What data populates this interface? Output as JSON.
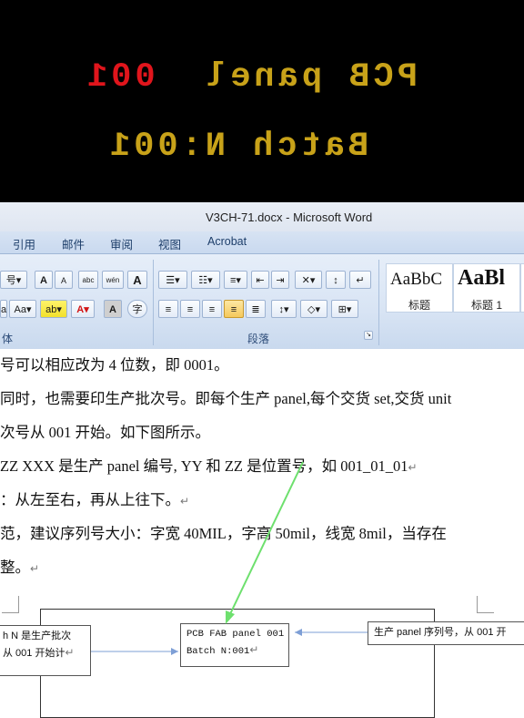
{
  "pcb_preview": {
    "line1_number": "001",
    "line1_text": "PCB panel",
    "line2_text": "Batch N:001",
    "number_color": "#e0151c",
    "text_color": "#c8a219"
  },
  "window": {
    "title": "V3CH-71.docx - Microsoft Word"
  },
  "tabs": [
    "引用",
    "邮件",
    "审阅",
    "视图",
    "Acrobat"
  ],
  "ribbon": {
    "font_group_label": "体",
    "paragraph_group_label": "段落",
    "font_buttons": [
      "号",
      "A",
      "A",
      "abc",
      "wén",
      "A"
    ],
    "font_buttons_row2": [
      "a",
      "Aa",
      "ab",
      "A",
      "A",
      "字"
    ],
    "styles": [
      {
        "sample": "AaBbC",
        "name": "标题"
      },
      {
        "sample": "AaBl",
        "name": "标题 1"
      }
    ]
  },
  "document": {
    "lines": [
      "号可以相应改为 4 位数，即 0001。",
      "同时，也需要印生产批次号。即每个生产 panel,每个交货 set,交货 unit",
      "次号从 001 开始。如下图所示。",
      "ZZ   XXX  是生产 panel 编号, YY  和  ZZ   是位置号，如 001_01_01",
      "：从左至右，再从上往下。",
      "范，建议序列号大小：字宽 40MIL，字高 50mil，线宽 8mil，当存在",
      "整。"
    ],
    "callout_left": [
      "h  N  是生产批次",
      "从 001 开始计"
    ],
    "callout_center": [
      "PCB  FAB  panel  001",
      "Batch N:001"
    ],
    "callout_right": "生产 panel  序列号，从 001 开"
  }
}
